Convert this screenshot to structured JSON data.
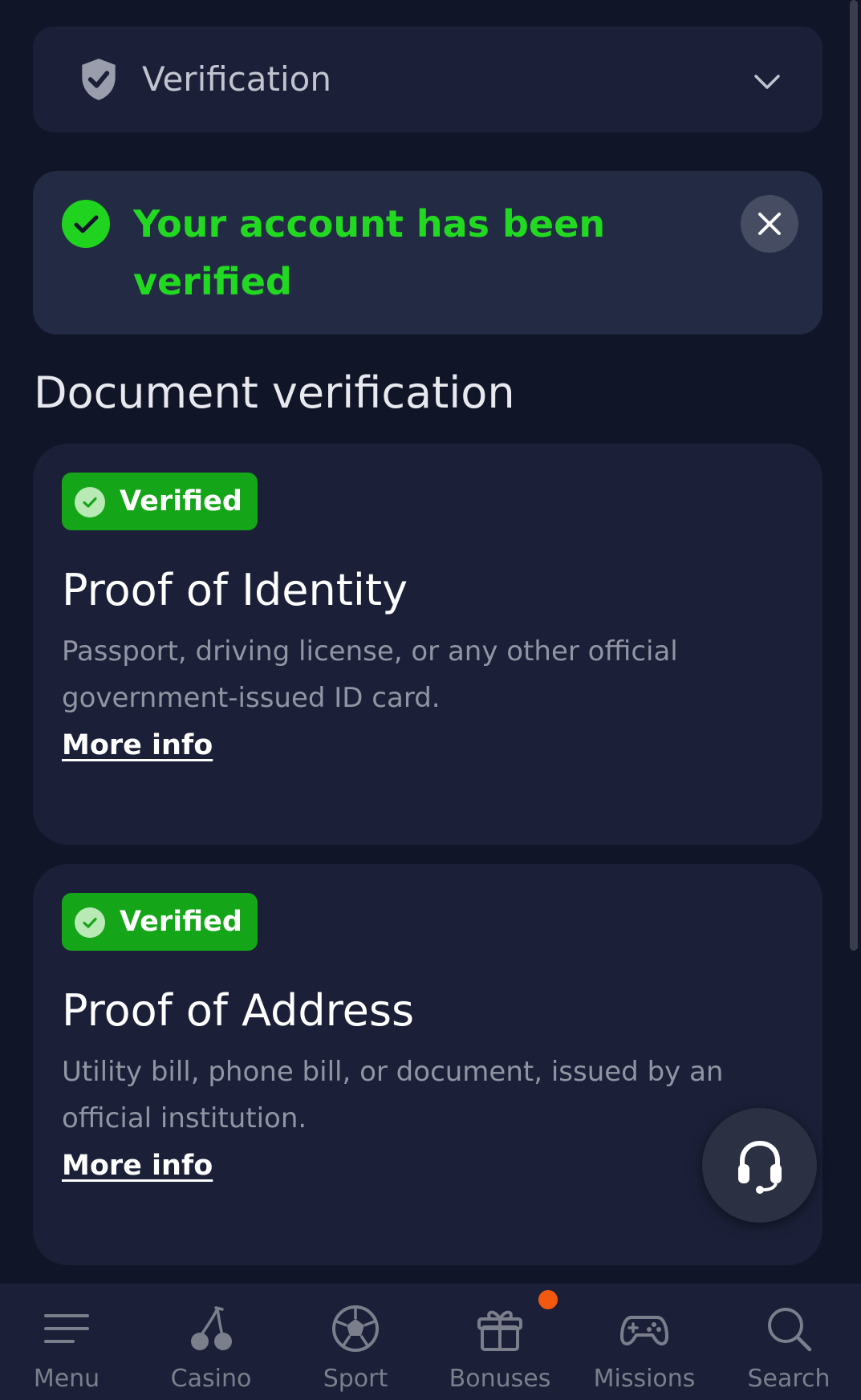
{
  "verification": {
    "title": "Verification"
  },
  "alert": {
    "message": "Your account has been verified"
  },
  "section_title": "Document verification",
  "documents": [
    {
      "status": "Verified",
      "title": "Proof of Identity",
      "description": "Passport, driving license, or any other official government-issued ID card.",
      "link": "More info"
    },
    {
      "status": "Verified",
      "title": "Proof of Address",
      "description": "Utility bill, phone bill, or document, issued by an official institution.",
      "link": "More info"
    }
  ],
  "bottom_nav": [
    {
      "label": "Menu",
      "icon": "menu-icon"
    },
    {
      "label": "Casino",
      "icon": "cherry-icon"
    },
    {
      "label": "Sport",
      "icon": "soccer-ball-icon"
    },
    {
      "label": "Bonuses",
      "icon": "gift-icon",
      "has_notification": true
    },
    {
      "label": "Missions",
      "icon": "gamepad-icon"
    },
    {
      "label": "Search",
      "icon": "search-icon"
    }
  ],
  "colors": {
    "background": "#111528",
    "card": "#1b2038",
    "success_text": "#22d922",
    "badge": "#15a518",
    "notification": "#f2590f"
  }
}
